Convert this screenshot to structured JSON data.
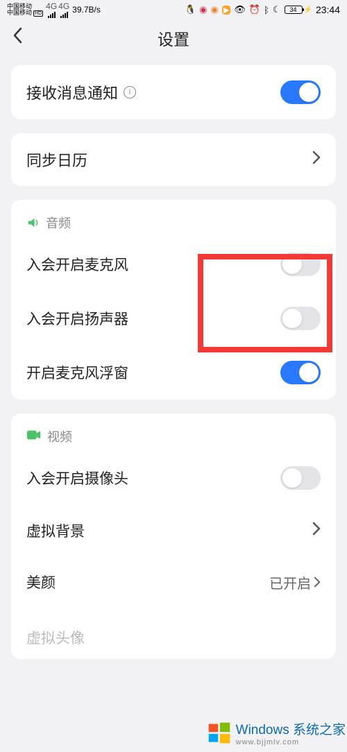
{
  "statusbar": {
    "carrier1": "中国移动",
    "carrier2": "中国移动",
    "hd": "HD",
    "net": "4G",
    "speed": "39.7B/s",
    "battery": "34",
    "time": "23:44"
  },
  "header": {
    "title": "设置"
  },
  "rows": {
    "notify": {
      "label": "接收消息通知",
      "toggle": true
    },
    "sync_calendar": {
      "label": "同步日历"
    },
    "audio_section": "音频",
    "mic_on_join": {
      "label": "入会开启麦克风",
      "toggle": false
    },
    "speaker_on_join": {
      "label": "入会开启扬声器",
      "toggle": false
    },
    "mic_float": {
      "label": "开启麦克风浮窗",
      "toggle": true
    },
    "video_section": "视频",
    "camera_on_join": {
      "label": "入会开启摄像头",
      "toggle": false
    },
    "virtual_bg": {
      "label": "虚拟背景"
    },
    "beauty": {
      "label": "美颜",
      "value": "已开启"
    },
    "virtual_avatar": {
      "label": "虚拟头像"
    }
  },
  "watermark": {
    "main": "Windows 系统之家",
    "sub": "www.bjjmlv.com"
  }
}
